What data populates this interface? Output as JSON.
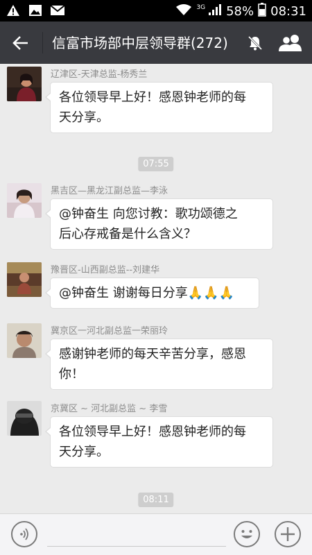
{
  "status_bar": {
    "network": "3G",
    "battery": "58%",
    "time": "08:31",
    "left_icons": [
      "warning-icon",
      "image-icon",
      "mail-icon"
    ],
    "right_icons": [
      "wifi-icon",
      "signal-icon",
      "battery-icon"
    ]
  },
  "header": {
    "title": "信富市场部中层领导群(272)",
    "icons": [
      "back-arrow-icon",
      "mute-bell-icon",
      "group-members-icon"
    ]
  },
  "messages": [
    {
      "sender": "辽津区-天津总监-杨秀兰",
      "lines": [
        "各位领导早上好！感恩钟老师的每",
        "天分享。"
      ],
      "avatar_colors": [
        "#3a2a22",
        "#c98e6e"
      ]
    },
    {
      "sender": "黑吉区—黑龙江副总监—李泳",
      "lines": [
        "@钟奋生 向您讨教：歌功颂德之",
        "后心存戒备是什么含义？"
      ],
      "avatar_colors": [
        "#e9e0e6",
        "#c79b7f"
      ]
    },
    {
      "sender": "豫晋区-山西副总监--刘建华",
      "lines": [
        "@钟奋生 谢谢每日分享🙏🙏🙏"
      ],
      "avatar_colors": [
        "#5b3b2a",
        "#9a4a3a"
      ]
    },
    {
      "sender": "冀京区一河北副总监一荣丽玲",
      "lines": [
        "感谢钟老师的每天辛苦分享，感恩",
        "你！"
      ],
      "avatar_colors": [
        "#d9d3c6",
        "#b98a6e"
      ]
    },
    {
      "sender": "京冀区 ~ 河北副总监 ~ 李雪",
      "lines": [
        "各位领导早上好！感恩钟老师的每",
        "天分享。"
      ],
      "avatar_colors": [
        "#dcdcdc",
        "#1e1e1e"
      ]
    }
  ],
  "timestamps": [
    "07:55",
    "08:11"
  ],
  "input_bar": {
    "icons": [
      "voice-icon",
      "emoji-icon",
      "plus-icon"
    ]
  },
  "colors": {
    "header_bg": "#393a3f",
    "chat_bg": "#ebebeb",
    "bubble_bg": "#ffffff",
    "timestamp_bg": "#cecece"
  }
}
